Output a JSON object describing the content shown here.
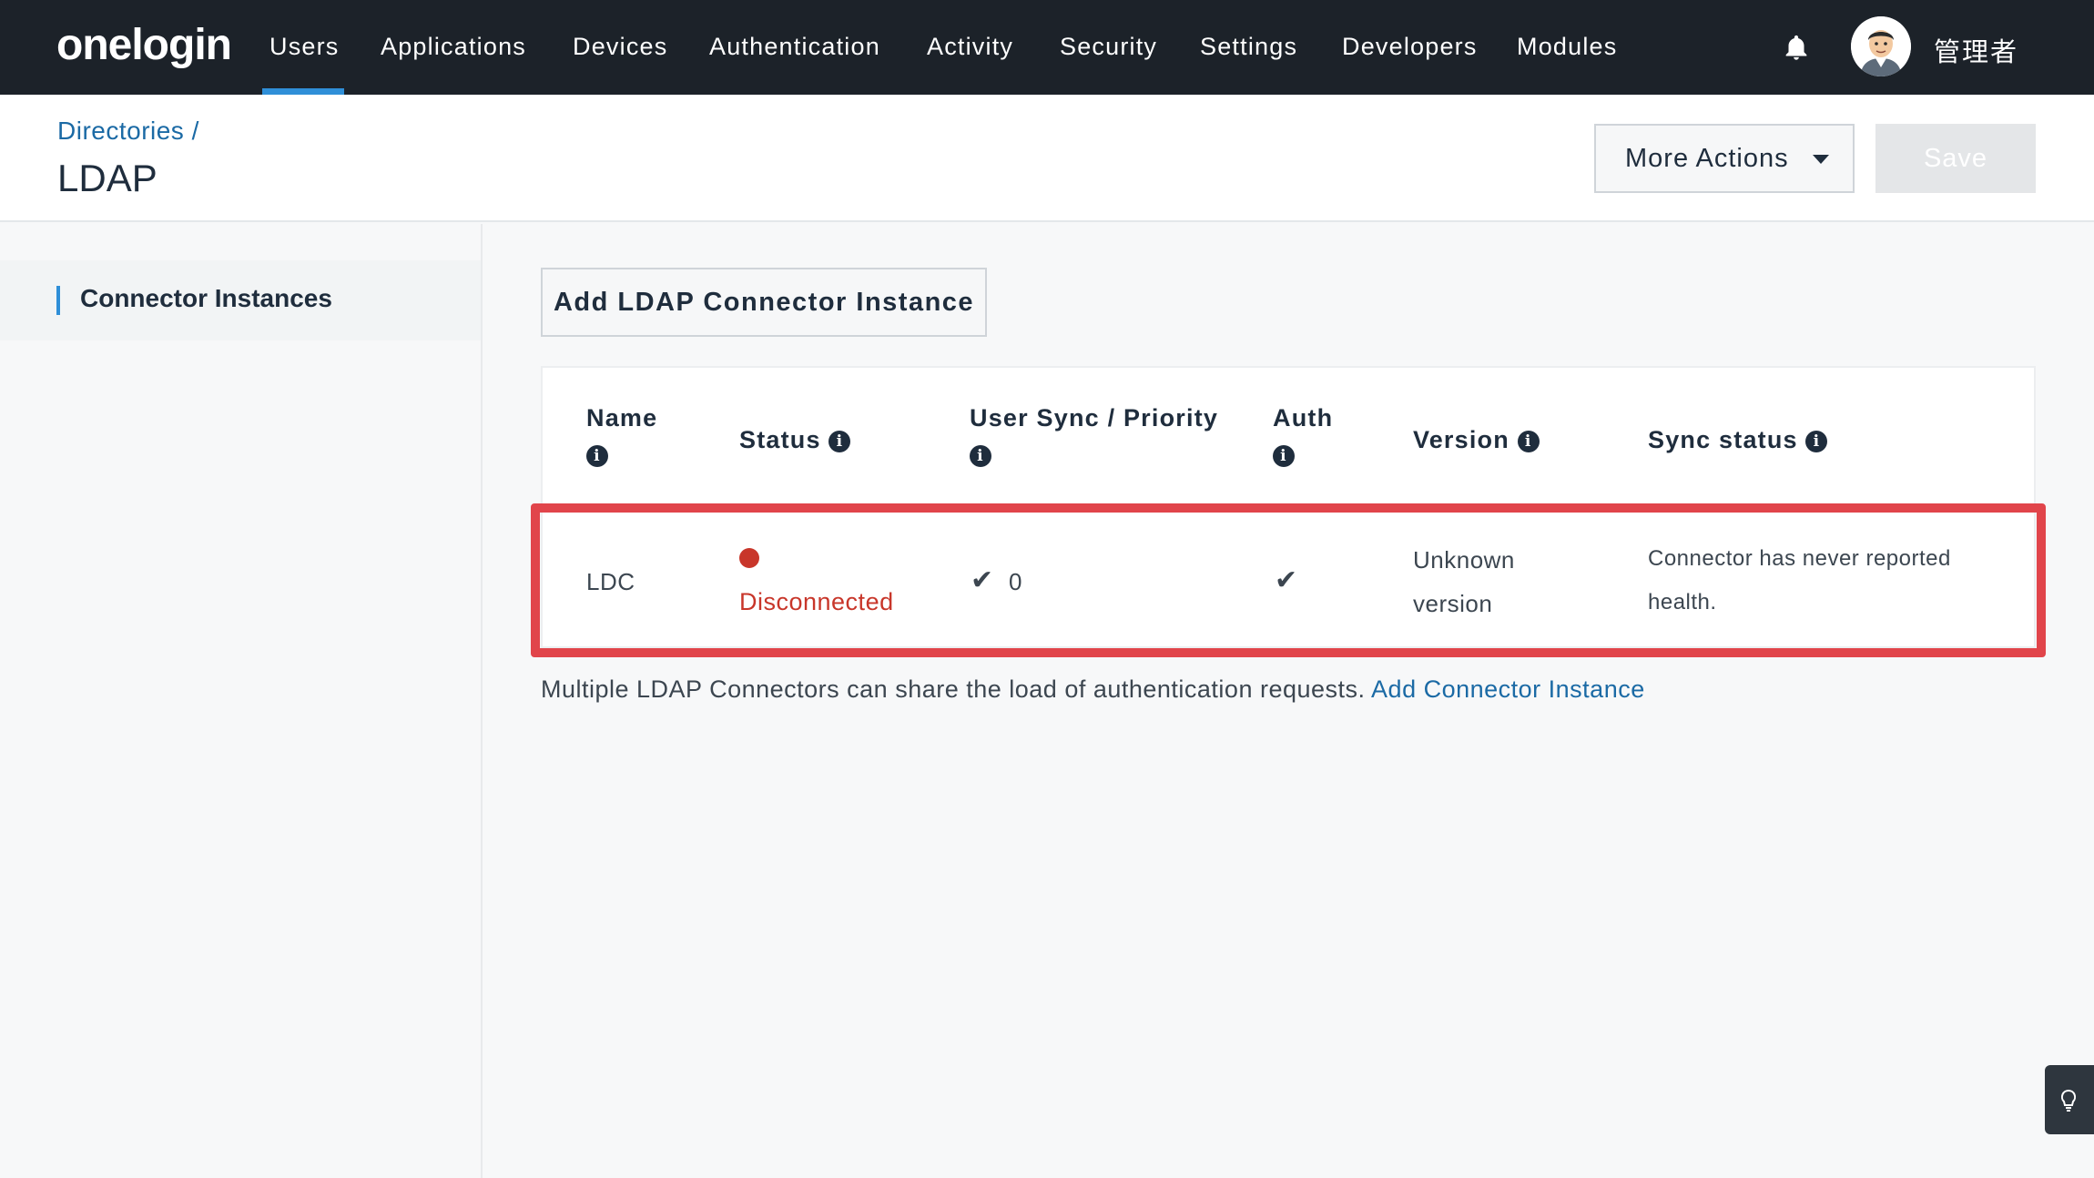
{
  "nav": {
    "logo": "onelogin",
    "items": [
      "Users",
      "Applications",
      "Devices",
      "Authentication",
      "Activity",
      "Security",
      "Settings",
      "Developers",
      "Modules"
    ],
    "active_index": 0,
    "user_name": "管理者"
  },
  "header": {
    "breadcrumb": "Directories /",
    "title": "LDAP",
    "more_actions_label": "More Actions",
    "save_label": "Save"
  },
  "sidebar": {
    "items": [
      {
        "label": "Connector Instances",
        "active": true
      }
    ]
  },
  "main": {
    "add_button_label": "Add LDAP Connector Instance",
    "table": {
      "columns": [
        "Name",
        "Status",
        "User Sync / Priority",
        "Auth",
        "Version",
        "Sync status"
      ],
      "rows": [
        {
          "name": "LDC",
          "status": "Disconnected",
          "user_sync_priority": "0",
          "auth": "check",
          "version_line1": "Unknown",
          "version_line2": "version",
          "sync_status_line1": "Connector has never reported",
          "sync_status_line2": "health."
        }
      ]
    },
    "footnote_text": "Multiple LDAP Connectors can share the load of authentication requests.",
    "footnote_link": "Add Connector Instance"
  },
  "colors": {
    "nav_bg": "#1c2229",
    "accent": "#2f8fd8",
    "link": "#1b6aa5",
    "error": "#c8362a",
    "highlight": "#e1454b"
  }
}
